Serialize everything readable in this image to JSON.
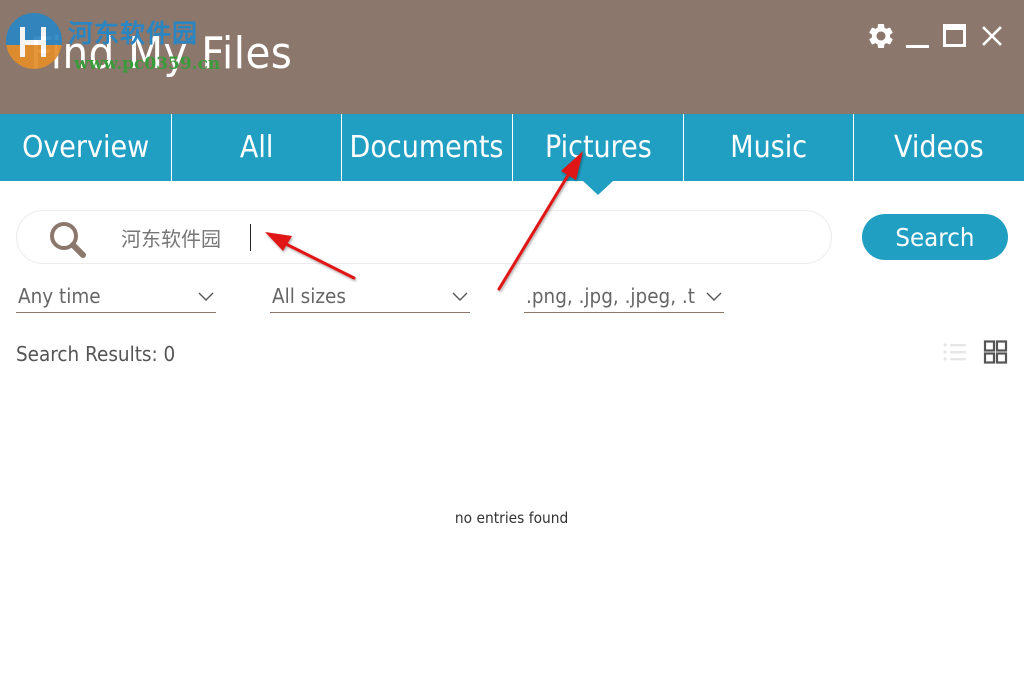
{
  "window": {
    "title": "Find My Files",
    "controls": {
      "settings": "gear-icon",
      "minimize": "minimize-icon",
      "maximize": "maximize-icon",
      "close": "close-icon"
    }
  },
  "watermark": {
    "site_name": "河东软件园",
    "url": "www.pc0359.cn"
  },
  "tabs": [
    {
      "label": "Overview",
      "active": false
    },
    {
      "label": "All",
      "active": false
    },
    {
      "label": "Documents",
      "active": false
    },
    {
      "label": "Pictures",
      "active": true
    },
    {
      "label": "Music",
      "active": false
    },
    {
      "label": "Videos",
      "active": false
    }
  ],
  "search": {
    "value": "河东软件园",
    "placeholder": "",
    "icon": "search-icon",
    "button_label": "Search"
  },
  "filters": {
    "time": {
      "selected": "Any time"
    },
    "size": {
      "selected": "All sizes"
    },
    "type": {
      "selected": ".png, .jpg, .jpeg, .t"
    }
  },
  "results": {
    "label": "Search Results:",
    "count": "0",
    "empty_message": "no entries found",
    "view_modes": [
      "list-view",
      "grid-view"
    ],
    "active_view": "grid-view"
  },
  "colors": {
    "titlebar": "#8c776c",
    "accent": "#219fc2",
    "annotation": "#e01515"
  }
}
